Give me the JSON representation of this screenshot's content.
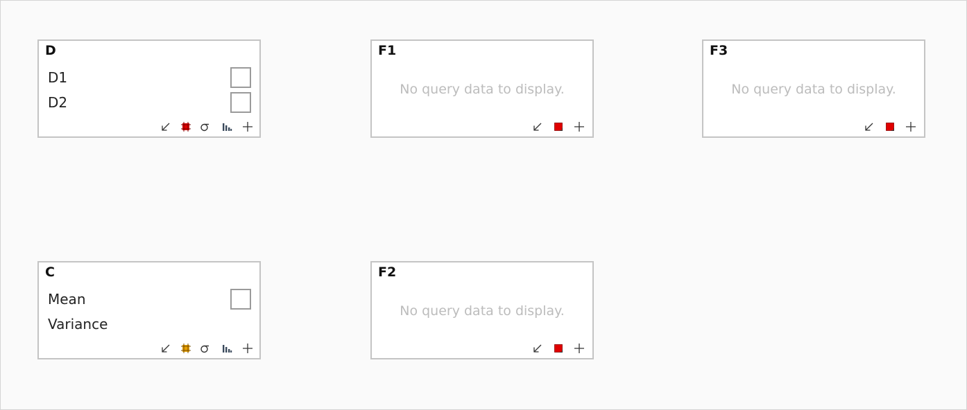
{
  "cards": {
    "d": {
      "title": "D",
      "rows": [
        "D1",
        "D2"
      ]
    },
    "f1": {
      "title": "F1",
      "empty_message": "No query data to display."
    },
    "f3": {
      "title": "F3",
      "empty_message": "No query data to display."
    },
    "c": {
      "title": "C",
      "rows": [
        "Mean",
        "Variance"
      ]
    },
    "f2": {
      "title": "F2",
      "empty_message": "No query data to display."
    }
  },
  "icons": {
    "collapse": "arrow-down-left-icon",
    "selection_red": "red-selection-icon",
    "selection_orange": "orange-selection-icon",
    "sigma": "sigma-icon",
    "chart": "bar-chart-icon",
    "add": "plus-icon"
  },
  "colors": {
    "selection_red": "#e00000",
    "selection_orange": "#e8a000",
    "chart_icon": "#3a4a5c"
  }
}
